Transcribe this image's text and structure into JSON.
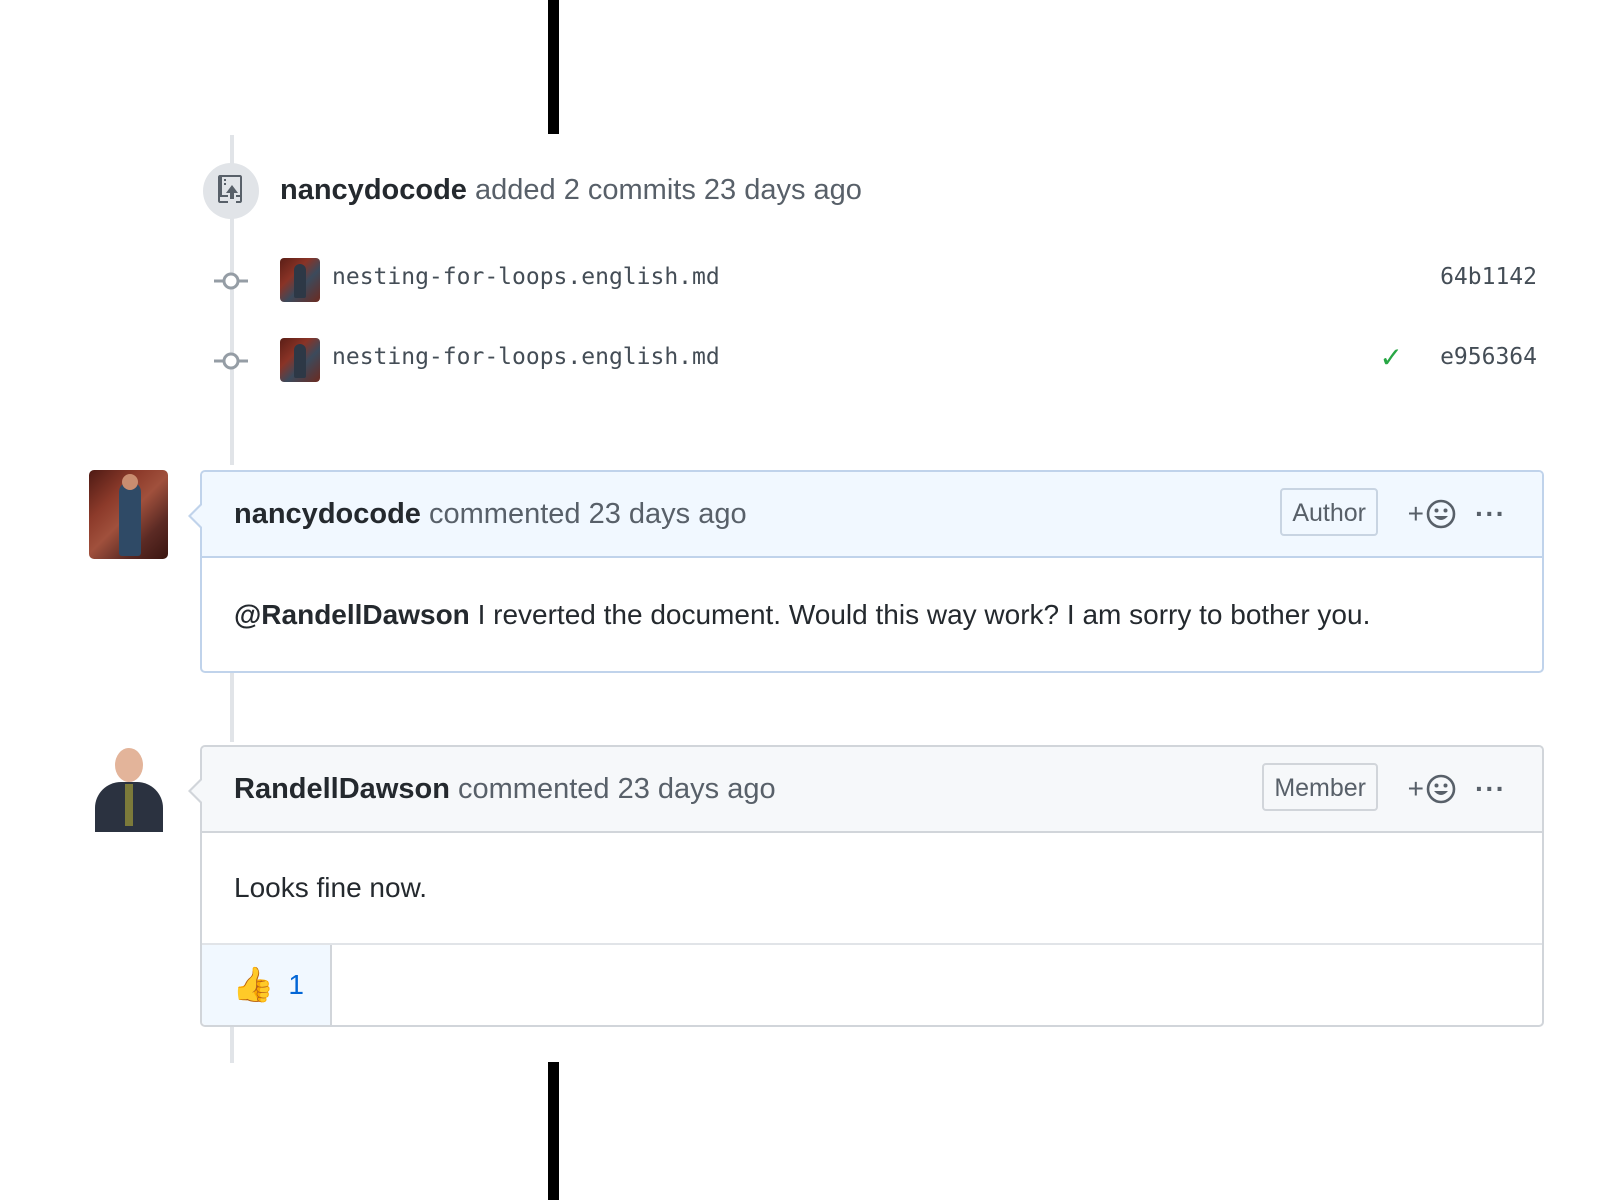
{
  "push_event": {
    "actor": "nancydocode",
    "action_text": "added 2 commits 23 days ago",
    "icon": "repo-push-icon"
  },
  "commits": [
    {
      "message": "nesting-for-loops.english.md",
      "sha": "64b1142",
      "status": "none"
    },
    {
      "message": "nesting-for-loops.english.md",
      "sha": "e956364",
      "status": "success"
    }
  ],
  "comments": [
    {
      "author": "nancydocode",
      "meta": "commented 23 days ago",
      "role": "Author",
      "mention": "@RandellDawson",
      "body": "I reverted the document. Would this way work? I am sorry to bother you."
    },
    {
      "author": "RandellDawson",
      "meta": "commented 23 days ago",
      "role": "Member",
      "body": "Looks fine now.",
      "reactions": [
        {
          "emoji": "👍",
          "count": "1"
        }
      ]
    }
  ],
  "header_actions": {
    "add_reaction": "+",
    "more": "···"
  },
  "colors": {
    "check": "#28a745",
    "reaction_count": "#0366d6",
    "author_header_bg": "#f1f8ff",
    "header_bg": "#f6f8fa"
  }
}
